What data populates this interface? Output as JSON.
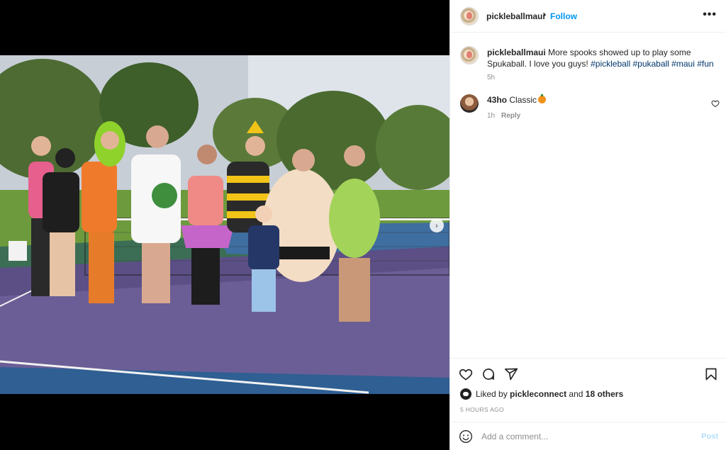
{
  "media": {
    "alt": "Group photo on a purple pickleball court",
    "dots": 3,
    "active_dot": 1
  },
  "post": {
    "author": "pickleballmaui",
    "separator": "•",
    "follow_label": "Follow",
    "more_label": "•••",
    "caption_text": "More spooks showed up to play some Spukaball. I love you guys!",
    "caption_tags": "#pickleball #pukaball #maui #fun",
    "caption_time": "5h"
  },
  "comments": [
    {
      "user": "43ho",
      "text": "Classic",
      "time": "1h",
      "reply_label": "Reply"
    }
  ],
  "likes": {
    "prefix": "Liked by",
    "user": "pickleconnect",
    "conjunction": "and",
    "others": "18 others"
  },
  "timestamp": "5 HOURS AGO",
  "add_comment": {
    "placeholder": "Add a comment...",
    "post_label": "Post"
  },
  "colors": {
    "link_blue": "#0095f6",
    "hashtag_blue": "#00376b",
    "muted": "#8e8e8e",
    "post_disabled": "#b2dffc"
  },
  "icons": [
    "heart-icon",
    "comment-icon",
    "share-icon",
    "bookmark-icon",
    "emoji-icon",
    "more-icon",
    "next-arrow-icon"
  ]
}
